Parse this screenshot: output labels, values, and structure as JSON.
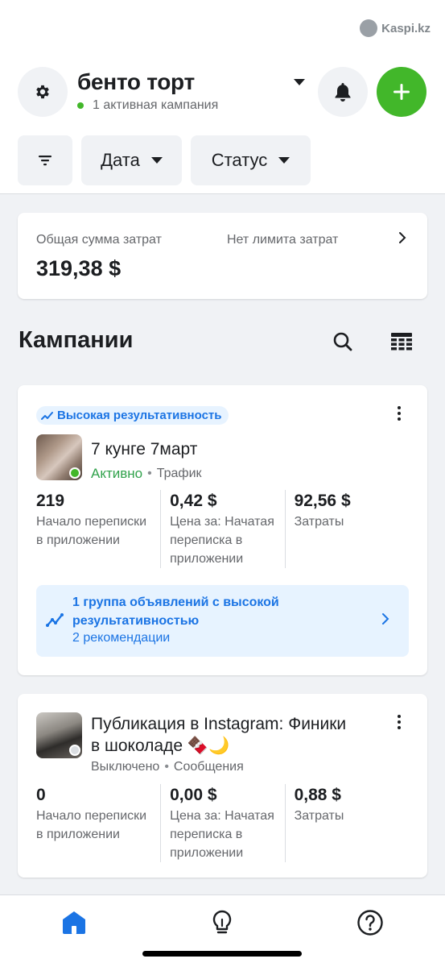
{
  "watermark": {
    "text": "Kaspi.kz"
  },
  "header": {
    "account_name": "бенто торт",
    "account_status": "1 активная кампания",
    "icons": {
      "settings": "gear-icon",
      "notifications": "bell-icon",
      "create": "plus-icon"
    }
  },
  "filters": {
    "date_label": "Дата",
    "status_label": "Статус"
  },
  "spend": {
    "total_label": "Общая сумма затрат",
    "total_value": "319,38 $",
    "limit_label": "Нет лимита затрат"
  },
  "campaigns_section": {
    "title": "Кампании"
  },
  "campaigns": [
    {
      "badge": "Высокая результативность",
      "name": "7 кунге 7март",
      "status": "Активно",
      "objective": "Трафик",
      "metrics": [
        {
          "value": "219",
          "label": "Начало переписки в приложении"
        },
        {
          "value": "0,42 $",
          "label": "Цена за: Начатая переписка в приложении"
        },
        {
          "value": "92,56 $",
          "label": "Затраты"
        }
      ],
      "recommendation": {
        "title": "1 группа объявлений с высокой результативностью",
        "subtitle": "2 рекомендации"
      }
    },
    {
      "name": "Публикация в Instagram: Финики в шоколаде 🍫🌙",
      "status": "Выключено",
      "objective": "Сообщения",
      "metrics": [
        {
          "value": "0",
          "label": "Начало переписки в приложении"
        },
        {
          "value": "0,00 $",
          "label": "Цена за: Начатая переписка в приложении"
        },
        {
          "value": "0,88 $",
          "label": "Затраты"
        }
      ]
    }
  ],
  "colors": {
    "accent": "#1b74e4",
    "active": "#31a24c",
    "create_button": "#42b72a"
  }
}
